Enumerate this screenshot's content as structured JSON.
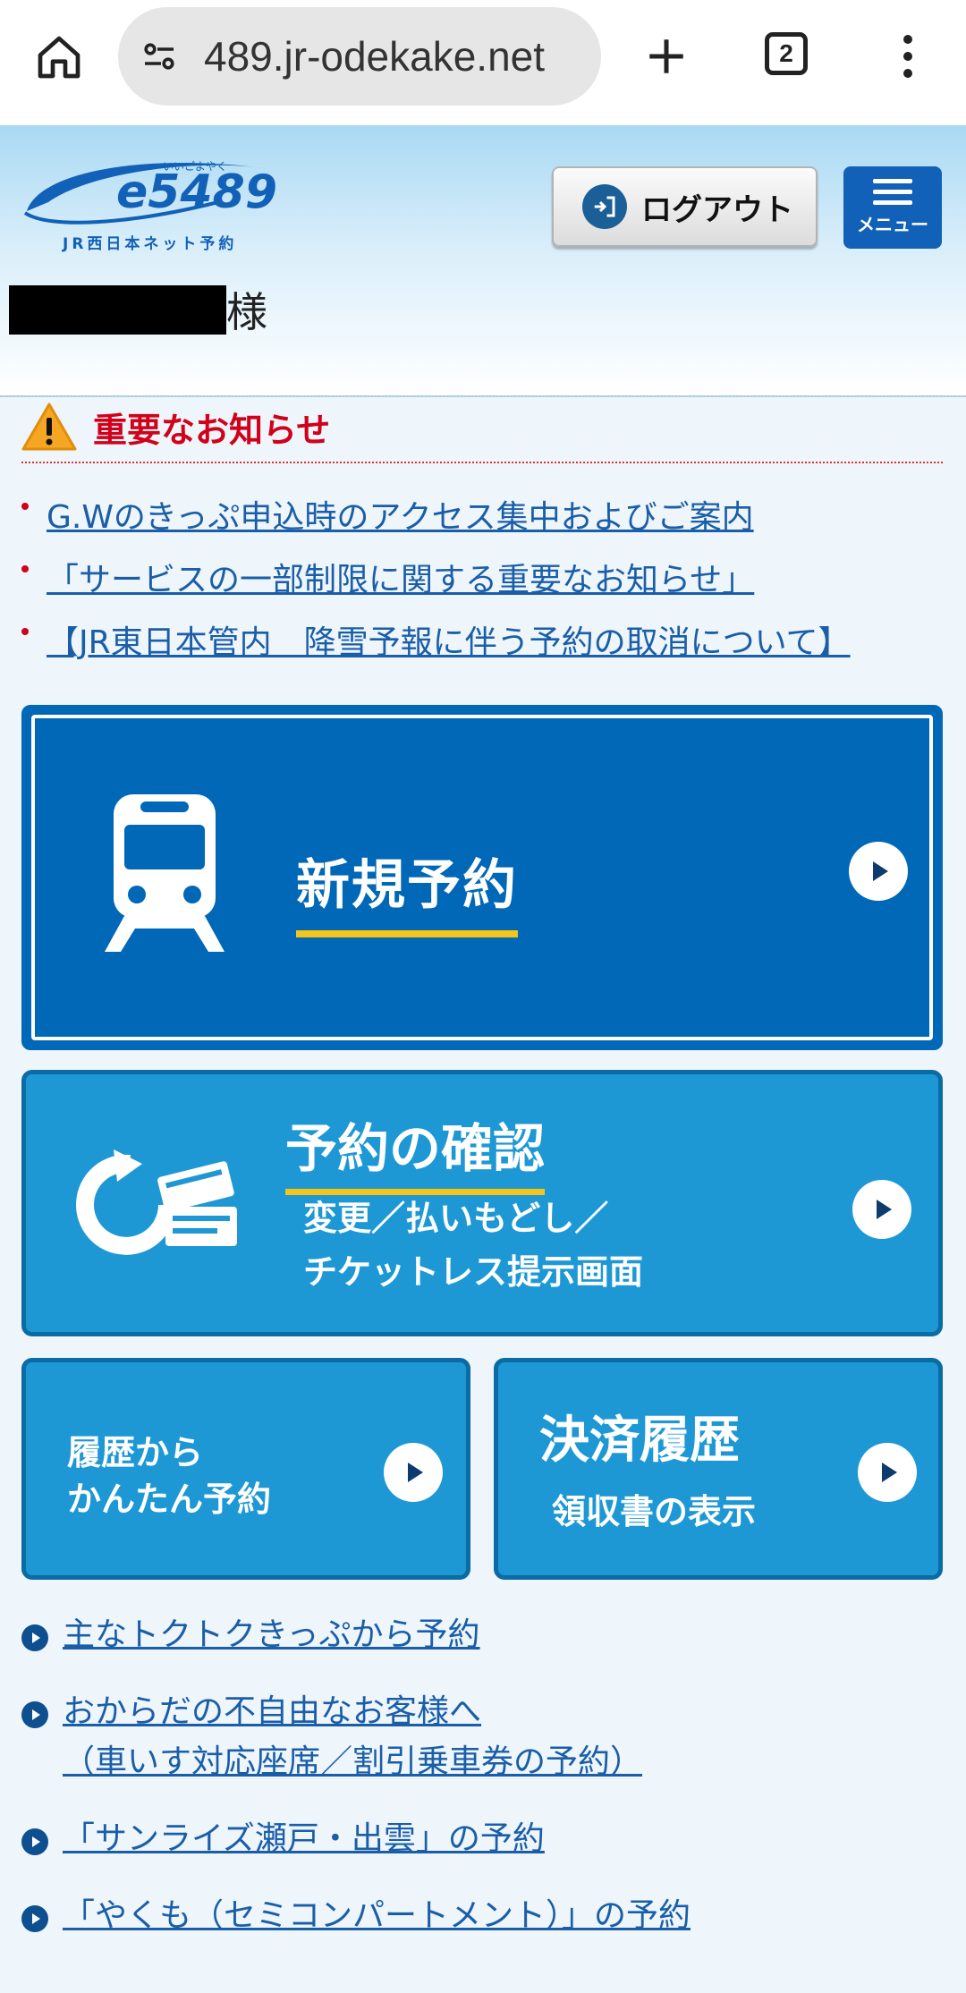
{
  "browser": {
    "url": "489.jr-odekake.net",
    "tab_count": "2"
  },
  "header": {
    "logo_text": "e5489",
    "logo_ruby": "いいごよやく",
    "logo_sub": "JR西日本ネット予約",
    "logout_label": "ログアウト",
    "menu_label": "メニュー",
    "honorific": "様"
  },
  "notices": {
    "title": "重要なお知らせ",
    "items": [
      "G.Wのきっぷ申込時のアクセス集中およびご案内",
      "「サービスの一部制限に関する重要なお知らせ」",
      "【JR東日本管内　降雪予報に伴う予約の取消について】"
    ]
  },
  "actions": {
    "new_reservation": "新規予約",
    "confirm_title": "予約の確認",
    "confirm_sub1": "変更／払いもどし／",
    "confirm_sub2": "チケットレス提示画面",
    "history_line1": "履歴から",
    "history_line2": "かんたん予約",
    "payment_title": "決済履歴",
    "payment_sub": "領収書の表示"
  },
  "links": [
    {
      "line1": "主なトクトクきっぷから予約",
      "line2": ""
    },
    {
      "line1": "おからだの不自由なお客様へ",
      "line2": "（車いす対応座席／割引乗車券の予約）"
    },
    {
      "line1": "「サンライズ瀬戸・出雲」の予約",
      "line2": ""
    },
    {
      "line1": "「やくも（セミコンパートメント）」の予約",
      "line2": ""
    }
  ],
  "colors": {
    "primary_blue": "#0068b7",
    "light_blue": "#1e98d4",
    "accent_yellow": "#f5c518",
    "alert_red": "#d0021b",
    "link_blue": "#1a5ea8"
  }
}
